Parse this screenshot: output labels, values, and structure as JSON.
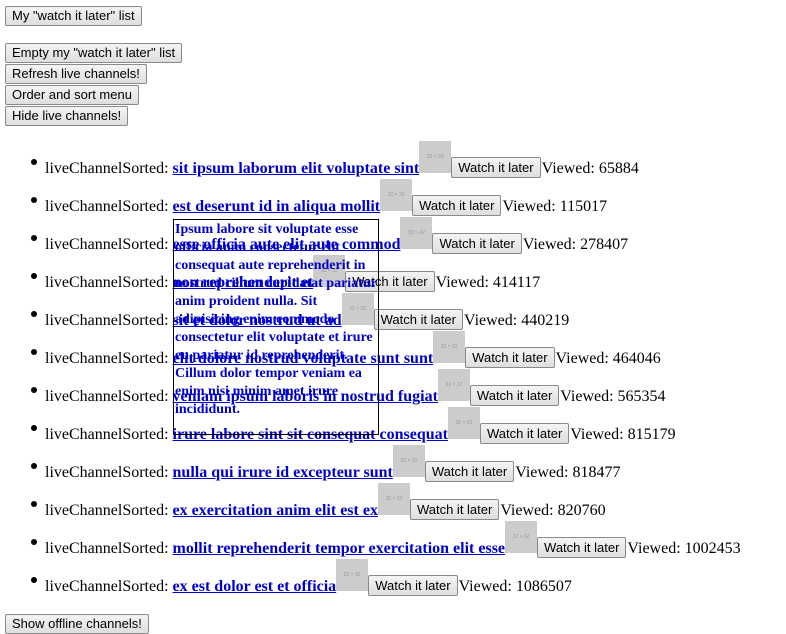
{
  "buttons": {
    "watch_later_list": "My \"watch it later\" list",
    "empty_list": "Empty my \"watch it later\" list",
    "refresh_live": "Refresh live channels!",
    "order_sort": "Order and sort menu",
    "hide_live": "Hide live channels!",
    "show_offline": "Show offline channels!"
  },
  "channel_prefix": "liveChannelSorted:",
  "thumb_text": "32 × 32",
  "watch_label": "Watch it later",
  "viewed_label": "Viewed:",
  "channels": [
    {
      "name": "sit ipsum laborum elit voluptate sint",
      "viewed": "65884"
    },
    {
      "name": "est deserunt id in aliqua mollit",
      "viewed": "115017"
    },
    {
      "name": "esse officia aute elit aute commod",
      "viewed": "278407"
    },
    {
      "name": "non reprehenderit et",
      "viewed": "414117"
    },
    {
      "name": "sit et dolor nostrud ut ad",
      "viewed": "440219"
    },
    {
      "name": "elit dolore nostrud voluptate sunt sunt",
      "viewed": "464046"
    },
    {
      "name": "veniam ipsum laboris in nostrud fugiat",
      "viewed": "565354"
    },
    {
      "name": "irure labore sint sit consequat consequat",
      "viewed": "815179"
    },
    {
      "name": "nulla qui irure id excepteur sunt",
      "viewed": "818477"
    },
    {
      "name": "ex exercitation anim elit est ex",
      "viewed": "820760"
    },
    {
      "name": "mollit reprehenderit tempor exercitation elit esse",
      "viewed": "1002453"
    },
    {
      "name": "ex est dolor est et officia",
      "viewed": "1086507"
    }
  ],
  "tooltip_text": "Ipsum labore sit voluptate esse officia anim consectetur elit consequat aute reprehenderit in nostrud cillum cupidatat pariatur anim proident nulla. Sit adipisicing enim commodo consectetur elit voluptate et irure eu pariatur id reprehenderit. Cillum dolor tempor veniam ea enim nisi minim amet irure incididunt."
}
